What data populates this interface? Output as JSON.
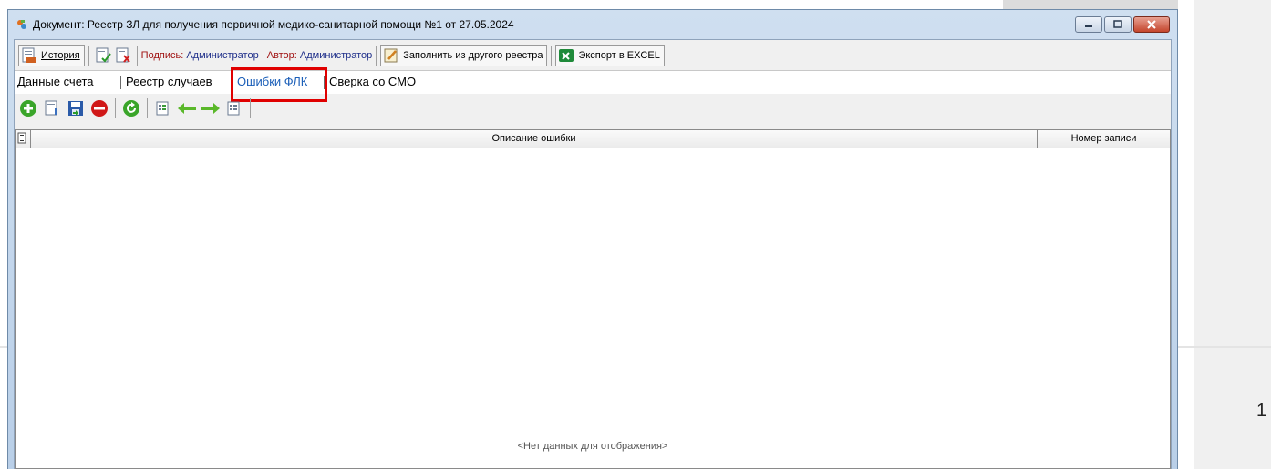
{
  "window": {
    "title": "Документ: Реестр ЗЛ для получения первичной медико-санитарной помощи №1 от 27.05.2024"
  },
  "toolbar": {
    "history_label": "История",
    "signature_prefix": "Подпись: ",
    "signature_value": "Администратор",
    "author_prefix": "Автор: ",
    "author_value": "Администратор",
    "fill_from_registry_label": "Заполнить из другого реестра",
    "export_excel_label": "Экспорт в EXCEL"
  },
  "tabs": [
    {
      "label": "Данные счета",
      "active": false
    },
    {
      "label": "Реестр случаев",
      "active": false
    },
    {
      "label": "Ошибки ФЛК",
      "active": true
    },
    {
      "label": "Сверка со СМО",
      "active": false
    }
  ],
  "grid": {
    "columns": [
      "Описание ошибки",
      "Номер записи"
    ],
    "empty_text": "<Нет данных для отображения>"
  },
  "page_fragment": "1",
  "colors": {
    "highlight": "#e00000",
    "active_tab": "#1c5fb8",
    "signature_prefix": "#a01010",
    "signature_value": "#1f2f8a"
  }
}
